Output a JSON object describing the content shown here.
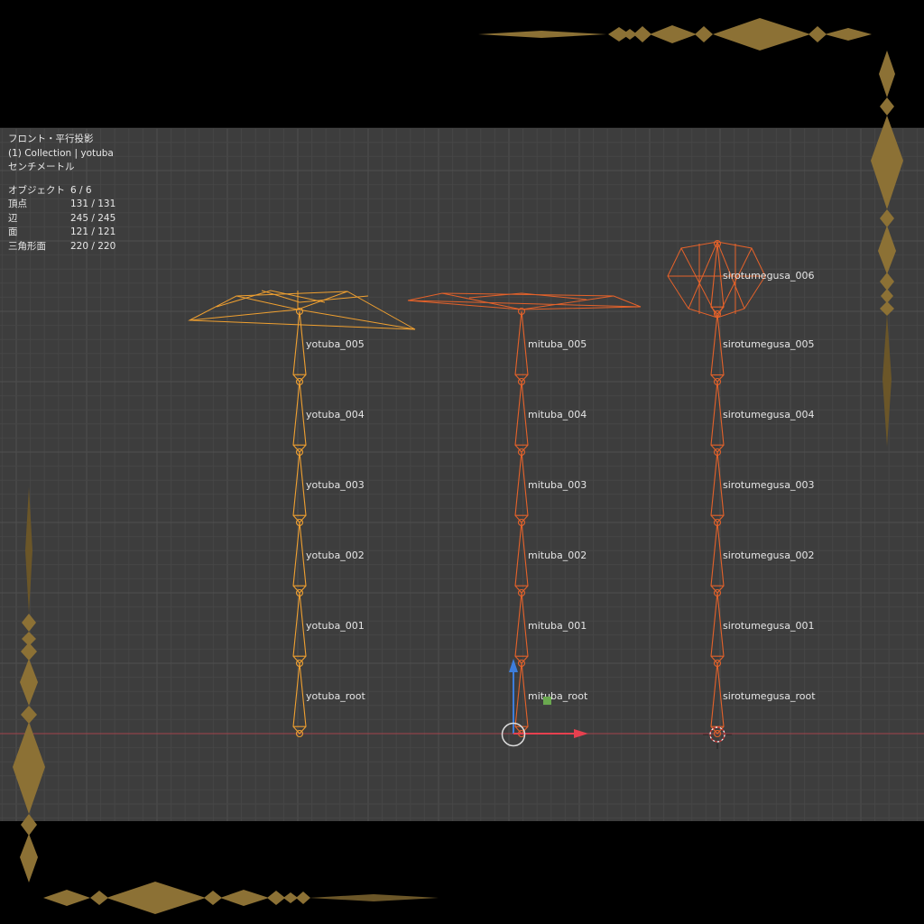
{
  "viewport": {
    "view_name": "フロント・平行投影",
    "collection_line": "(1) Collection | yotuba",
    "units": "センチメートル"
  },
  "stats": [
    {
      "label": "オブジェクト",
      "value": "6 / 6"
    },
    {
      "label": "頂点",
      "value": "131 / 131"
    },
    {
      "label": "辺",
      "value": "245 / 245"
    },
    {
      "label": "面",
      "value": "121 / 121"
    },
    {
      "label": "三角形面",
      "value": "220 / 220"
    }
  ],
  "armatures": [
    {
      "name": "yotuba",
      "color": "#f0a030",
      "bones": [
        "yotuba_root",
        "yotuba_001",
        "yotuba_002",
        "yotuba_003",
        "yotuba_004",
        "yotuba_005"
      ]
    },
    {
      "name": "mituba",
      "color": "#e5622a",
      "bones": [
        "mituba_root",
        "mituba_001",
        "mituba_002",
        "mituba_003",
        "mituba_004",
        "mituba_005"
      ]
    },
    {
      "name": "sirotumegusa",
      "color": "#e5622a",
      "bones": [
        "sirotumegusa_root",
        "sirotumegusa_001",
        "sirotumegusa_002",
        "sirotumegusa_003",
        "sirotumegusa_004",
        "sirotumegusa_005",
        "sirotumegusa_006"
      ]
    }
  ],
  "gizmo": {
    "x_axis_color": "#e8404f",
    "z_axis_color": "#3d7ddb",
    "y_axis_color": "#6aa84f"
  },
  "colors": {
    "viewport_background": "#3d3d3d",
    "letterbox": "#000000",
    "decoration_gold": "#8c7135"
  }
}
